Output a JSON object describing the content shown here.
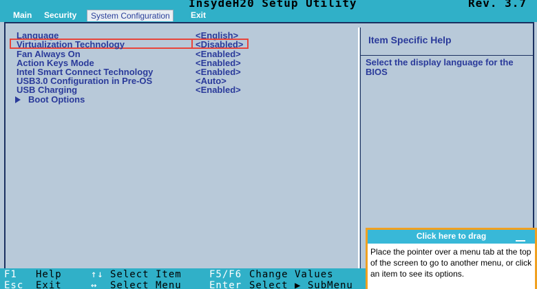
{
  "window": {
    "title": "InsydeH20 Setup Utility",
    "revision": "Rev. 3.7"
  },
  "menu": {
    "tabs": [
      {
        "label": "Main"
      },
      {
        "label": "Security"
      },
      {
        "label": "System Configuration",
        "active": true
      },
      {
        "label": "Exit"
      }
    ]
  },
  "settings": {
    "items": [
      {
        "label": "Language",
        "value": "<English>"
      },
      {
        "label": "Virtualization Technology",
        "value": "<Disabled>",
        "highlighted": true
      },
      {
        "label": "Fan Always On",
        "value": "<Enabled>"
      },
      {
        "label": "Action Keys Mode",
        "value": "<Enabled>"
      },
      {
        "label": "Intel Smart Connect Technology",
        "value": "<Enabled>"
      },
      {
        "label": "USB3.0 Configuration in Pre-OS",
        "value": "<Auto>"
      },
      {
        "label": "USB Charging",
        "value": "<Enabled>"
      },
      {
        "label": "Boot Options",
        "submenu": true
      }
    ]
  },
  "help": {
    "title": "Item Specific Help",
    "text": "Select the display language for the BIOS"
  },
  "keys": [
    {
      "key": "F1",
      "desc": "Help"
    },
    {
      "key": "↑↓",
      "desc": "Select Item"
    },
    {
      "key": "F5/F6",
      "desc": "Change Values"
    },
    {
      "key": "Esc",
      "desc": "Exit"
    },
    {
      "key": "↔",
      "desc": "Select Menu"
    },
    {
      "key": "Enter",
      "desc": "Select ▶ SubMenu"
    }
  ],
  "drag_panel": {
    "header": "Click here to drag",
    "body": "Place the pointer over a menu tab at the top of the screen to go to another menu, or click an item to see its options."
  },
  "colors": {
    "bar": "#30b0c8",
    "background": "#b8c9d9",
    "text": "#2a3a9a",
    "highlight_border": "#e8443a",
    "drag_border": "#f0a020"
  }
}
